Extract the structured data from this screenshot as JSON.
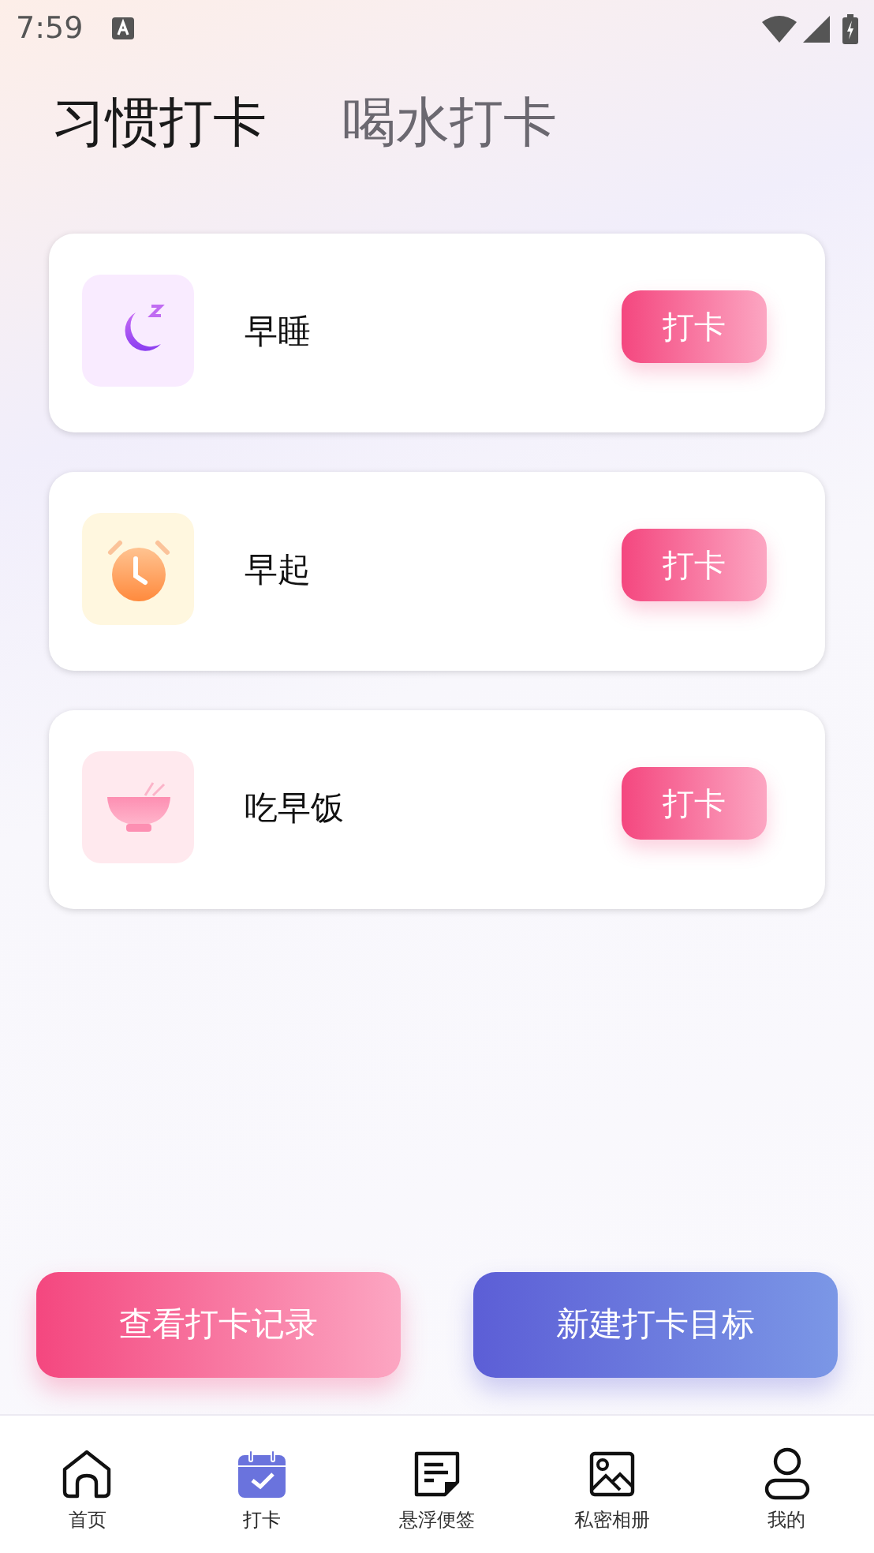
{
  "status_bar": {
    "time": "7:59"
  },
  "tabs": [
    {
      "label": "习惯打卡",
      "selected": true
    },
    {
      "label": "喝水打卡",
      "selected": false
    }
  ],
  "habits": [
    {
      "kind": "moon",
      "name": "早睡",
      "button": "打卡"
    },
    {
      "kind": "alarm",
      "name": "早起",
      "button": "打卡"
    },
    {
      "kind": "bowl",
      "name": "吃早饭",
      "button": "打卡"
    }
  ],
  "actions": [
    {
      "kind": "pink",
      "label": "查看打卡记录"
    },
    {
      "kind": "blue",
      "label": "新建打卡目标"
    }
  ],
  "nav": [
    {
      "kind": "home",
      "label": "首页",
      "selected": false
    },
    {
      "kind": "calendar",
      "label": "打卡",
      "selected": true
    },
    {
      "kind": "note",
      "label": "悬浮便签",
      "selected": false
    },
    {
      "kind": "image",
      "label": "私密相册",
      "selected": false
    },
    {
      "kind": "user",
      "label": "我的",
      "selected": false
    }
  ]
}
